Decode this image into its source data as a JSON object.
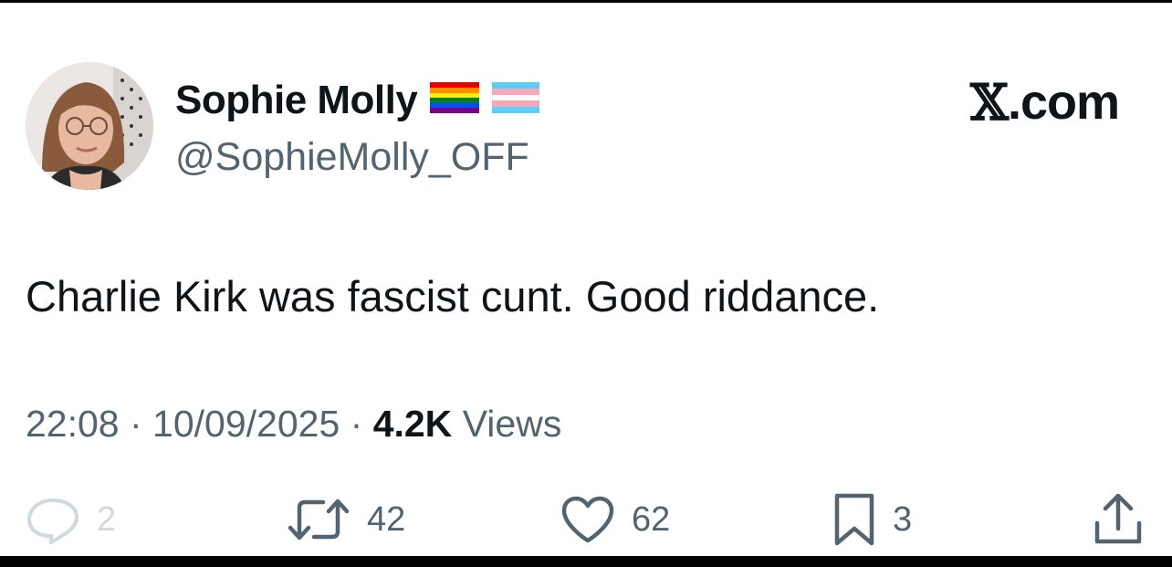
{
  "author": {
    "display_name": "Sophie Molly",
    "handle": "@SophieMolly_OFF",
    "badges": [
      "rainbow-flag-icon",
      "transgender-flag-icon"
    ]
  },
  "brand": {
    "label": "X.com",
    "x": "𝕏",
    "rest": ".com"
  },
  "tweet": {
    "text": "Charlie Kirk was fascist cunt. Good riddance."
  },
  "meta": {
    "time": "22:08",
    "sep1": " · ",
    "date": "10/09/2025",
    "sep2": " · ",
    "views_count": "4.2K",
    "views_label": " Views"
  },
  "actions": {
    "reply": {
      "icon": "reply-icon",
      "count": "2"
    },
    "retweet": {
      "icon": "retweet-icon",
      "count": "42"
    },
    "like": {
      "icon": "heart-icon",
      "count": "62"
    },
    "bookmark": {
      "icon": "bookmark-icon",
      "count": "3"
    },
    "share": {
      "icon": "share-icon"
    }
  },
  "colors": {
    "text": "#0f1419",
    "secondary": "#536471",
    "reply_faded": "#cfd9de",
    "background": "#ffffff"
  }
}
